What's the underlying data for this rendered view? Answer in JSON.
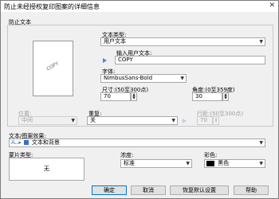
{
  "window": {
    "title": "防止未经授权复印图案的详细信息",
    "close_glyph": "✕"
  },
  "prevent_text": {
    "group_label": "防止文本",
    "preview_watermark": "COPY",
    "text_type_label": "文本类型:",
    "text_type_value": "用户文本",
    "user_text_label": "输入用户文本:",
    "user_text_value": "COPY",
    "font_label": "字体:",
    "font_value": "NimbusSans-Bold",
    "size_label": "尺寸:(50至300点)",
    "size_value": "70",
    "angle_label": "角度:(0至359度)",
    "angle_value": "30",
    "position_label": "位置:",
    "position_value": "中间",
    "repeat_label": "重复:",
    "repeat_value": "关",
    "line_spacing_label": "行距:(50至300点)",
    "line_spacing_value": "70"
  },
  "text_pattern_effect": {
    "label": "文本/图案效果:",
    "value": "文本和背景"
  },
  "pattern_type": {
    "label": "蒙片类型:",
    "value": "无"
  },
  "density": {
    "label": "浓度:",
    "value": "标准"
  },
  "color": {
    "label": "彩色:",
    "value": "黑色",
    "swatch": "#000000"
  },
  "buttons": {
    "ok": "确定",
    "cancel": "取消",
    "defaults": "恢复默认设置",
    "help": "帮助"
  }
}
